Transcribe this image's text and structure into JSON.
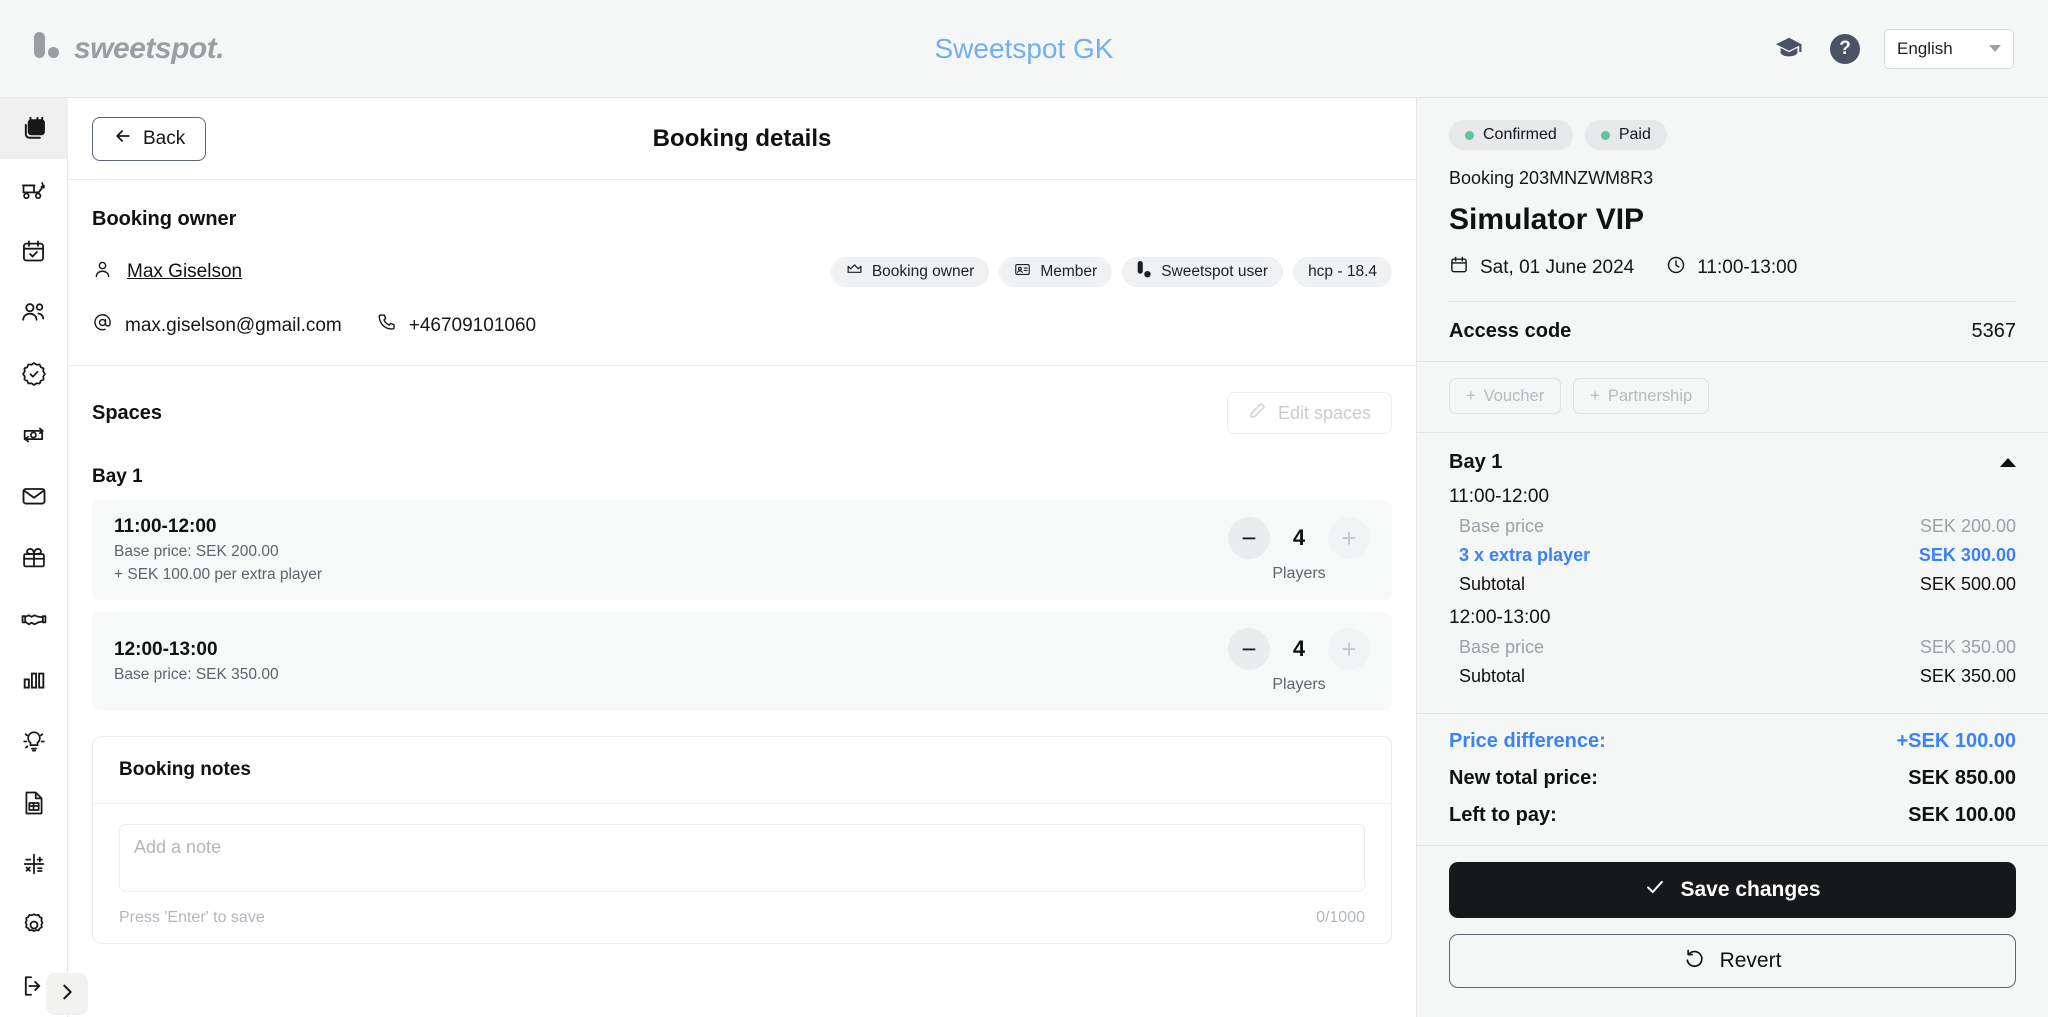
{
  "header": {
    "logo_text": "sweetspot.",
    "club_title": "Sweetspot GK",
    "graduation_icon": "graduation-cap-icon",
    "help_icon": "help-circle-icon",
    "language": "English"
  },
  "sidebar": {
    "items": [
      {
        "icon": "calendar-stack-icon",
        "name": "bookings",
        "active": true
      },
      {
        "icon": "golf-cart-icon",
        "name": "golf-cart"
      },
      {
        "icon": "calendar-check-icon",
        "name": "schedule"
      },
      {
        "icon": "users-icon",
        "name": "members"
      },
      {
        "icon": "badge-check-icon",
        "name": "verification"
      },
      {
        "icon": "money-exchange-icon",
        "name": "payments"
      },
      {
        "icon": "envelope-icon",
        "name": "messages"
      },
      {
        "icon": "gift-icon",
        "name": "vouchers"
      },
      {
        "icon": "handshake-icon",
        "name": "partnerships"
      },
      {
        "icon": "bar-chart-icon",
        "name": "statistics"
      },
      {
        "icon": "lightbulb-icon",
        "name": "insights"
      },
      {
        "icon": "document-table-icon",
        "name": "reports"
      },
      {
        "icon": "calculator-icon",
        "name": "accounting"
      },
      {
        "icon": "gear-icon",
        "name": "settings"
      },
      {
        "icon": "logout-icon",
        "name": "logout"
      }
    ],
    "collapse_icon": "chevron-right-icon"
  },
  "main": {
    "back_label": "Back",
    "back_icon": "arrow-left-icon",
    "title": "Booking details",
    "owner": {
      "section_title": "Booking owner",
      "name": "Max Giselson",
      "name_icon": "person-icon",
      "email": "max.giselson@gmail.com",
      "email_icon": "at-icon",
      "phone": "+46709101060",
      "phone_icon": "phone-icon",
      "badges": [
        {
          "label": "Booking owner",
          "icon": "crown-icon"
        },
        {
          "label": "Member",
          "icon": "id-card-icon"
        },
        {
          "label": "Sweetspot user",
          "icon": "sweetspot-logo-icon"
        },
        {
          "label": "hcp - 18.4",
          "icon": ""
        }
      ]
    },
    "spaces": {
      "section_title": "Spaces",
      "edit_label": "Edit spaces",
      "edit_icon": "pencil-icon",
      "bay_label": "Bay 1",
      "slots": [
        {
          "time": "11:00-12:00",
          "base_price": "Base price: SEK 200.00",
          "extra": "+ SEK 100.00 per extra player",
          "players": "4",
          "players_label": "Players",
          "minus_icon": "minus-icon",
          "plus_icon": "plus-icon"
        },
        {
          "time": "12:00-13:00",
          "base_price": "Base price: SEK 350.00",
          "extra": "",
          "players": "4",
          "players_label": "Players",
          "minus_icon": "minus-icon",
          "plus_icon": "plus-icon"
        }
      ]
    },
    "notes": {
      "title": "Booking notes",
      "placeholder": "Add a note",
      "value": "",
      "hint": "Press 'Enter' to save",
      "counter": "0/1000"
    }
  },
  "right": {
    "statuses": [
      {
        "label": "Confirmed",
        "color": "#5bc49a"
      },
      {
        "label": "Paid",
        "color": "#5bc49a"
      }
    ],
    "booking_id": "Booking 203MNZWM8R3",
    "title": "Simulator VIP",
    "date": "Sat, 01 June 2024",
    "date_icon": "calendar-icon",
    "time": "11:00-13:00",
    "time_icon": "clock-icon",
    "access_code_label": "Access code",
    "access_code_value": "5367",
    "addons": [
      {
        "label": "Voucher",
        "icon": "plus-icon"
      },
      {
        "label": "Partnership",
        "icon": "plus-icon"
      }
    ],
    "breakdown": {
      "bay_label": "Bay 1",
      "collapse_icon": "caret-up-icon",
      "groups": [
        {
          "time": "11:00-12:00",
          "lines": [
            {
              "label": "Base price",
              "amount": "SEK 200.00",
              "style": "muted"
            },
            {
              "label": "3 x extra player",
              "amount": "SEK 300.00",
              "style": "blue"
            },
            {
              "label": "Subtotal",
              "amount": "SEK 500.00",
              "style": "normal"
            }
          ]
        },
        {
          "time": "12:00-13:00",
          "lines": [
            {
              "label": "Base price",
              "amount": "SEK 350.00",
              "style": "muted"
            },
            {
              "label": "Subtotal",
              "amount": "SEK 350.00",
              "style": "normal"
            }
          ]
        }
      ]
    },
    "totals": [
      {
        "label": "Price difference:",
        "amount": "+SEK 100.00",
        "style": "blue"
      },
      {
        "label": "New total price:",
        "amount": "SEK 850.00",
        "style": "normal"
      },
      {
        "label": "Left to pay:",
        "amount": "SEK 100.00",
        "style": "normal"
      }
    ],
    "save_label": "Save changes",
    "save_icon": "check-icon",
    "revert_label": "Revert",
    "revert_icon": "undo-icon"
  },
  "colors": {
    "accent_blue": "#3b82f6",
    "title_blue": "#73aef0",
    "status_green": "#5bc49a",
    "dark_button": "#17181a",
    "panel_bg": "#f5f6f6"
  }
}
